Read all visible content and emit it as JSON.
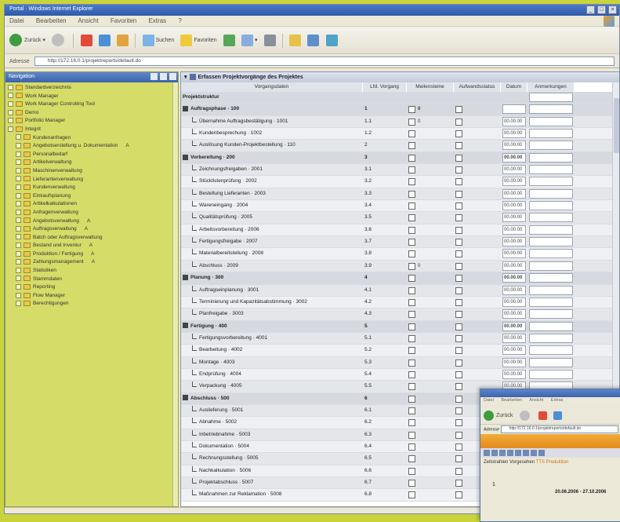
{
  "window": {
    "title": "Portal · Windows Internet Explorer",
    "controls": [
      "_",
      "□",
      "×"
    ]
  },
  "menubar": {
    "items": [
      "Datei",
      "Bearbeiten",
      "Ansicht",
      "Favoriten",
      "Extras",
      "?"
    ]
  },
  "toolbar": {
    "back_label": "Zurück",
    "search_label": "Suchen",
    "favorites_label": "Favoriten"
  },
  "address": {
    "label": "Adresse",
    "url": "http://172.16.0.1/projektreports/default.do"
  },
  "sidebar": {
    "title": "Navigation",
    "root_label": "Standardverzeichnis",
    "items": [
      {
        "label": "Work Manager",
        "level": 0,
        "mark": ""
      },
      {
        "label": "Work Manager Controlling Tool",
        "level": 0,
        "mark": ""
      },
      {
        "label": "Demo",
        "level": 0,
        "mark": ""
      },
      {
        "label": "Portfolio Manager",
        "level": 0,
        "mark": ""
      },
      {
        "label": "Integrit",
        "level": 0,
        "mark": ""
      },
      {
        "label": "Kundenanfragen",
        "level": 1,
        "mark": ""
      },
      {
        "label": "Angebotserstellung u. Dokumentation",
        "level": 1,
        "mark": "A"
      },
      {
        "label": "Personalbedarf",
        "level": 1,
        "mark": ""
      },
      {
        "label": "Artikelverwaltung",
        "level": 1,
        "mark": ""
      },
      {
        "label": "Maschinenverwaltung",
        "level": 1,
        "mark": ""
      },
      {
        "label": "Lieferantenverwaltung",
        "level": 1,
        "mark": ""
      },
      {
        "label": "Kundenverwaltung",
        "level": 1,
        "mark": ""
      },
      {
        "label": "Einkaufsplanung",
        "level": 1,
        "mark": ""
      },
      {
        "label": "Artikelkalkulationen",
        "level": 1,
        "mark": ""
      },
      {
        "label": "Anfragenverwaltung",
        "level": 1,
        "mark": ""
      },
      {
        "label": "Angebotsverwaltung",
        "level": 1,
        "mark": "A"
      },
      {
        "label": "Auftragsverwaltung",
        "level": 1,
        "mark": "A"
      },
      {
        "label": "Batch oder Auftragsverwaltung",
        "level": 1,
        "mark": ""
      },
      {
        "label": "Bestand und Inventur",
        "level": 1,
        "mark": "A"
      },
      {
        "label": "Produktion / Fertigung",
        "level": 1,
        "mark": "A"
      },
      {
        "label": "Zahlungsmanagement",
        "level": 1,
        "mark": "A"
      },
      {
        "label": "Statistiken",
        "level": 1,
        "mark": ""
      },
      {
        "label": "Stammdaten",
        "level": 1,
        "mark": ""
      },
      {
        "label": "Reporting",
        "level": 1,
        "mark": ""
      },
      {
        "label": "Flow Manager",
        "level": 1,
        "mark": ""
      },
      {
        "label": "Berechtigungen",
        "level": 1,
        "mark": ""
      }
    ]
  },
  "main": {
    "title": "Erfassen Projektvorgänge des Projektes",
    "subheader": "Vorgangsdaten",
    "columns": [
      "",
      "Lfd. Vorgang",
      "Meilensteine",
      "Aufwandsstatus",
      "Datum",
      "Anmerkungen"
    ],
    "rows": [
      {
        "type": "root",
        "name": "Projektstruktur",
        "nr": "",
        "m_label": "",
        "a_label": "",
        "date": ""
      },
      {
        "type": "group",
        "name": "Auftragsphase · 100",
        "nr": "1",
        "m_label": "0",
        "a_label": "",
        "date": ""
      },
      {
        "type": "item",
        "name": "Übernahme Auftragsbestätigung · 1001",
        "nr": "1.1",
        "m_label": "0",
        "a_label": "",
        "date": "00.00.00"
      },
      {
        "type": "item",
        "name": "Kundenbesprechung · 1002",
        "nr": "1.2",
        "m_label": "",
        "a_label": "",
        "date": "00.00.00"
      },
      {
        "type": "item",
        "name": "Auslösung Kunden-Projektbestellung · 110",
        "nr": "2",
        "m_label": "",
        "a_label": "",
        "date": "00.00.00"
      },
      {
        "type": "group",
        "name": "Vorbereitung · 200",
        "nr": "3",
        "m_label": "",
        "a_label": "",
        "date": "00.00.00"
      },
      {
        "type": "item",
        "name": "Zeichnungsfreigaben · 2001",
        "nr": "3.1",
        "m_label": "",
        "a_label": "",
        "date": "00.00.00"
      },
      {
        "type": "item",
        "name": "Stücklistenprüfung · 2002",
        "nr": "3.2",
        "m_label": "",
        "a_label": "",
        "date": "00.00.00"
      },
      {
        "type": "item",
        "name": "Bestellung Lieferanten · 2003",
        "nr": "3.3",
        "m_label": "",
        "a_label": "",
        "date": "00.00.00"
      },
      {
        "type": "item",
        "name": "Wareneingang · 2004",
        "nr": "3.4",
        "m_label": "",
        "a_label": "",
        "date": "00.00.00"
      },
      {
        "type": "item",
        "name": "Qualitätsprüfung · 2005",
        "nr": "3.5",
        "m_label": "",
        "a_label": "",
        "date": "00.00.00"
      },
      {
        "type": "item",
        "name": "Arbeitsvorbereitung · 2006",
        "nr": "3.6",
        "m_label": "",
        "a_label": "",
        "date": "00.00.00"
      },
      {
        "type": "item",
        "name": "Fertigungsfreigabe · 2007",
        "nr": "3.7",
        "m_label": "",
        "a_label": "",
        "date": "00.00.00"
      },
      {
        "type": "item",
        "name": "Materialbereitstellung · 2008",
        "nr": "3.8",
        "m_label": "",
        "a_label": "",
        "date": "00.00.00"
      },
      {
        "type": "item",
        "name": "Abschluss · 2009",
        "nr": "3.9",
        "m_label": "0",
        "a_label": "",
        "date": "00.00.00"
      },
      {
        "type": "group",
        "name": "Planung · 300",
        "nr": "4",
        "m_label": "",
        "a_label": "",
        "date": "00.00.00"
      },
      {
        "type": "item",
        "name": "Auftragseinplanung · 3001",
        "nr": "4.1",
        "m_label": "",
        "a_label": "",
        "date": "00.00.00"
      },
      {
        "type": "item",
        "name": "Terminierung und Kapazitätsabstimmung · 3002",
        "nr": "4.2",
        "m_label": "",
        "a_label": "",
        "date": "00.00.00"
      },
      {
        "type": "item",
        "name": "Planfreigabe · 3003",
        "nr": "4.3",
        "m_label": "",
        "a_label": "",
        "date": "00.00.00"
      },
      {
        "type": "group",
        "name": "Fertigung · 400",
        "nr": "5",
        "m_label": "",
        "a_label": "",
        "date": "00.00.00"
      },
      {
        "type": "item",
        "name": "Fertigungsvorbereitung · 4001",
        "nr": "5.1",
        "m_label": "",
        "a_label": "",
        "date": "00.00.00"
      },
      {
        "type": "item",
        "name": "Bearbeitung · 4002",
        "nr": "5.2",
        "m_label": "",
        "a_label": "",
        "date": "00.00.00"
      },
      {
        "type": "item",
        "name": "Montage · 4003",
        "nr": "5.3",
        "m_label": "",
        "a_label": "",
        "date": "00.00.00"
      },
      {
        "type": "item",
        "name": "Endprüfung · 4004",
        "nr": "5.4",
        "m_label": "",
        "a_label": "",
        "date": "00.00.00"
      },
      {
        "type": "item",
        "name": "Verpackung · 4005",
        "nr": "5.5",
        "m_label": "",
        "a_label": "",
        "date": "00.00.00"
      },
      {
        "type": "group",
        "name": "Abschluss · 500",
        "nr": "6",
        "m_label": "",
        "a_label": "",
        "date": "00.00.00"
      },
      {
        "type": "item",
        "name": "Auslieferung · 5001",
        "nr": "6.1",
        "m_label": "",
        "a_label": "",
        "date": "00.00.00"
      },
      {
        "type": "item",
        "name": "Abnahme · 5002",
        "nr": "6.2",
        "m_label": "",
        "a_label": "",
        "date": "00.00.00"
      },
      {
        "type": "item",
        "name": "Inbetriebnahme · 5003",
        "nr": "6.3",
        "m_label": "",
        "a_label": "",
        "date": "00.00.00"
      },
      {
        "type": "item",
        "name": "Dokumentation · 5004",
        "nr": "6.4",
        "m_label": "",
        "a_label": "",
        "date": "00.00.00"
      },
      {
        "type": "item",
        "name": "Rechnungsstellung · 5005",
        "nr": "6.5",
        "m_label": "",
        "a_label": "",
        "date": "00.00.00"
      },
      {
        "type": "item",
        "name": "Nachkalkulation · 5006",
        "nr": "6.6",
        "m_label": "",
        "a_label": "",
        "date": "00.00.00"
      },
      {
        "type": "item",
        "name": "Projektabschluss · 5007",
        "nr": "6.7",
        "m_label": "",
        "a_label": "",
        "date": "00.00.00"
      },
      {
        "type": "item",
        "name": "Maßnahmen zur Reklamation · 5008",
        "nr": "6.8",
        "m_label": "",
        "a_label": "",
        "date": "00.00.00"
      }
    ]
  },
  "overlay": {
    "menu": [
      "Datei",
      "Bearbeiten",
      "Ansicht",
      "Extras"
    ],
    "back_label": "Zurück",
    "address_label": "Adresse",
    "url": "http://172.16.0.1/projektreports/default.do",
    "info_label": "Zeitstrahlen Vorgesehen",
    "info_value": "TTS Produktion",
    "num": "1",
    "date_range": "20.06.2006 - 27.10.2006"
  },
  "colors": {
    "background": "#c9d33c",
    "sidebar": "#d5dc68",
    "titlebar": "#2f5aa8",
    "accent_orange": "#e58a1d"
  }
}
